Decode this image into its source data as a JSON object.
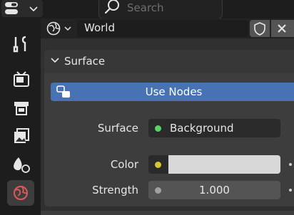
{
  "search": {
    "placeholder": "Search"
  },
  "header": {
    "datablock": "World"
  },
  "panel": {
    "title": "Surface",
    "use_nodes_label": "Use Nodes",
    "rows": [
      {
        "label": "Surface",
        "value": "Background",
        "socket_color": "#5bd16a"
      },
      {
        "label": "Color",
        "value": "",
        "socket_color": "#d6c732",
        "swatch": "#d8d8d8"
      },
      {
        "label": "Strength",
        "value": "1.000",
        "socket_color": "#a1a1a1"
      }
    ]
  },
  "colors": {
    "accent": "#4772b3",
    "world_icon": "#e05a5a"
  },
  "icons": [
    "editor-type-icon",
    "search-icon",
    "world-icon",
    "wrench-icon",
    "render-icon",
    "output-icon",
    "view-layer-icon",
    "scene-icon",
    "world-tab-icon",
    "shield-icon",
    "close-icon",
    "chevron-down-icon",
    "node-icon"
  ]
}
